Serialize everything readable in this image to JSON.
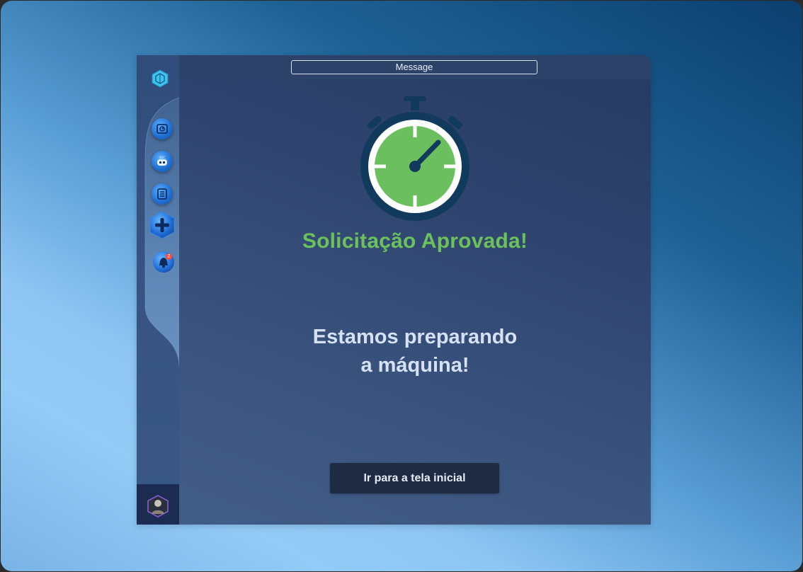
{
  "header": {
    "message_label": "Message"
  },
  "sidebar": {
    "items": [
      {
        "icon": "dashboard-icon"
      },
      {
        "icon": "robot-icon"
      },
      {
        "icon": "checklist-icon"
      },
      {
        "icon": "plus-icon"
      },
      {
        "icon": "bell-icon",
        "badge": "2"
      }
    ]
  },
  "main": {
    "status_title": "Solicitação Aprovada!",
    "message_line1": "Estamos preparando",
    "message_line2": "a máquina!",
    "home_button_label": "Ir para a tela inicial"
  },
  "colors": {
    "accent_green": "#6cc15d",
    "button_bg": "#1f2a43",
    "sidebar_dark": "#1b2b52"
  }
}
